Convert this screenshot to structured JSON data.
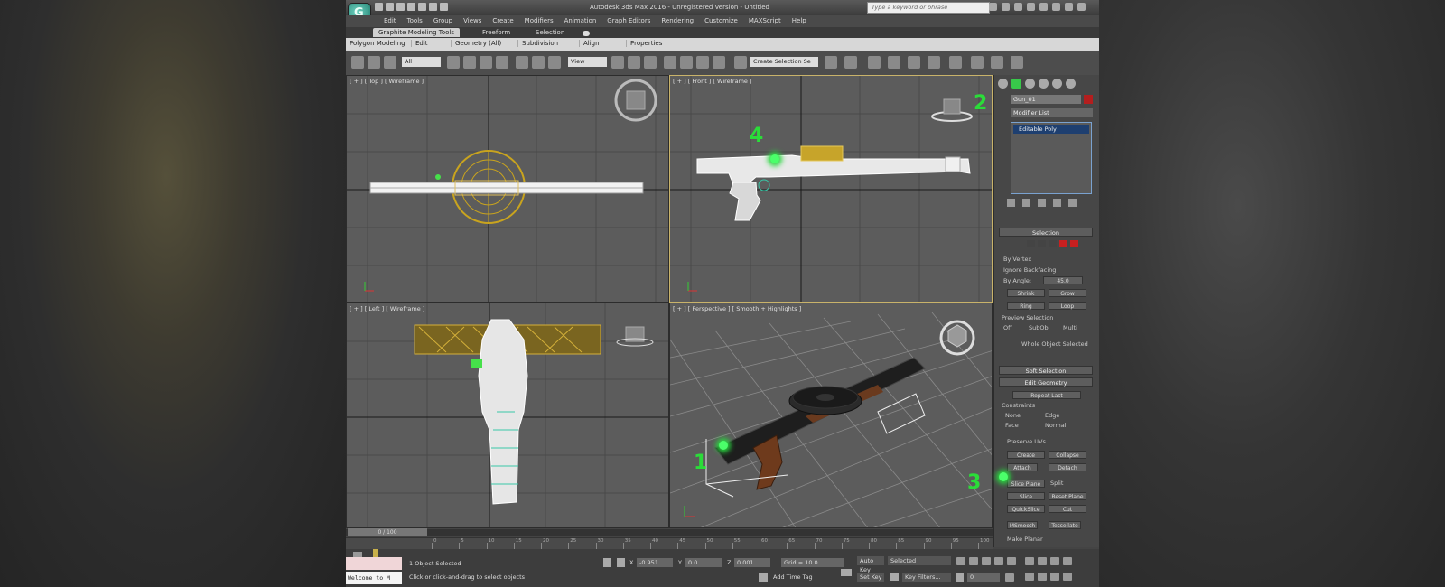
{
  "app": {
    "title": "Autodesk 3ds Max 2016   -   Unregistered Version   -   Untitled",
    "search_placeholder": "Type a keyword or phrase",
    "logo_glyph": "G"
  },
  "menu": [
    "Edit",
    "Tools",
    "Group",
    "Views",
    "Create",
    "Modifiers",
    "Animation",
    "Graph Editors",
    "Rendering",
    "Customize",
    "MAXScript",
    "Help"
  ],
  "ribbon_tabs": [
    "Graphite Modeling Tools",
    "Freeform",
    "Selection"
  ],
  "ribbon_panels": [
    "Polygon Modeling",
    "Edit",
    "Geometry (All)",
    "Subdivision",
    "Align",
    "Properties"
  ],
  "toolbar": {
    "selection_filter": "All",
    "ref_coord": "View",
    "named_selection": "Create Selection Se"
  },
  "viewports": {
    "top": "[ + ] [ Top ] [ Wireframe ]",
    "front": "[ + ] [ Front ] [ Wireframe ]",
    "left": "[ + ] [ Left ] [ Wireframe ]",
    "perspective": "[ + ] [ Perspective ] [ Smooth + Highlights ]"
  },
  "command_panel": {
    "object_name": "Gun_01",
    "modifier_list": "Modifier List",
    "stack_item": "Editable Poly",
    "colors": {
      "object": "#b41e1e",
      "accent": "#38c84a"
    },
    "selection": {
      "title": "Selection",
      "by_vertex": "By Vertex",
      "ignore_backfacing": "Ignore Backfacing",
      "by_angle": "By Angle:",
      "angle_value": "45.0",
      "shrink": "Shrink",
      "grow": "Grow",
      "ring": "Ring",
      "loop": "Loop",
      "preview": "Preview Selection",
      "off": "Off",
      "subobj": "SubObj",
      "multi": "Multi",
      "whole": "Whole Object Selected"
    },
    "soft_selection": "Soft Selection",
    "edit_geometry": {
      "title": "Edit Geometry",
      "repeat_last": "Repeat Last",
      "constraints": "Constraints",
      "none": "None",
      "edge": "Edge",
      "face": "Face",
      "normal": "Normal",
      "preserve_uvs": "Preserve UVs",
      "create": "Create",
      "collapse": "Collapse",
      "attach": "Attach",
      "detach": "Detach",
      "slice_plane": "Slice Plane",
      "split": "Split",
      "slice": "Slice",
      "reset_plane": "Reset Plane",
      "quickslice": "QuickSlice",
      "cut": "Cut",
      "msmooth": "MSmooth",
      "tessellate": "Tessellate",
      "make_planar": "Make Planar"
    }
  },
  "timeline": {
    "slider": "0 / 100",
    "ticks": [
      "0",
      "5",
      "10",
      "15",
      "20",
      "25",
      "30",
      "35",
      "40",
      "45",
      "50",
      "55",
      "60",
      "65",
      "70",
      "75",
      "80",
      "85",
      "90",
      "95",
      "100"
    ]
  },
  "status": {
    "welcome": "Welcome to M",
    "selected": "1 Object Selected",
    "prompt": "Click or click-and-drag to select objects",
    "x": "-0.951",
    "y": "0.0",
    "z": "0.001",
    "grid": "Grid = 10.0",
    "add_time_tag": "Add Time Tag",
    "auto_key": "Auto Key",
    "selected_dropdown": "Selected",
    "set_key": "Set Key",
    "key_filters": "Key Filters...",
    "frame": "0"
  },
  "markers": [
    "1",
    "2",
    "3",
    "4"
  ]
}
